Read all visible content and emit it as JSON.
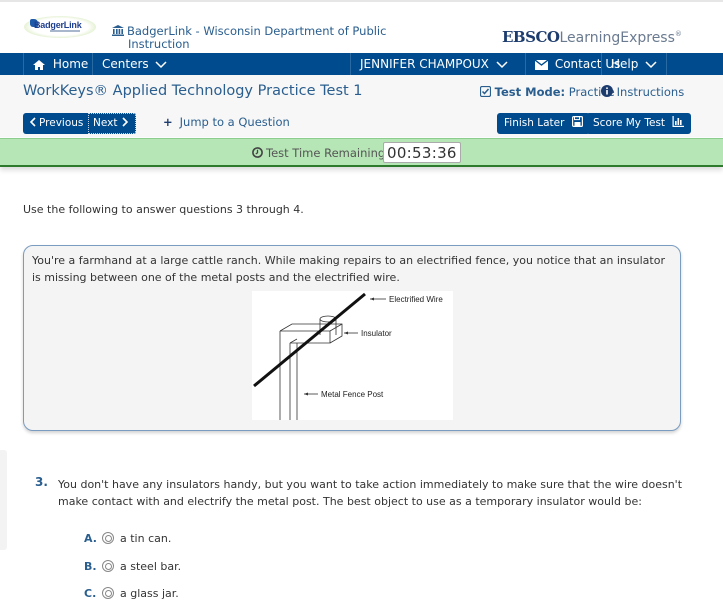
{
  "branding": {
    "logo_text": "BadgerLink",
    "institution": "BadgerLink - Wisconsin Department of Public",
    "institution_line2": "Instruction",
    "ebsco_bold": "EBSCO",
    "ebsco_light": "LearningExpress",
    "ebsco_reg": "®"
  },
  "nav": {
    "home": "Home",
    "centers": "Centers",
    "user": "JENNIFER CHAMPOUX",
    "contact": "Contact Us",
    "help": "Help"
  },
  "header": {
    "title": "WorkKeys® Applied Technology Practice Test 1",
    "test_mode_label": "Test Mode:",
    "test_mode_value": "Practice",
    "instructions": "Instructions"
  },
  "toolbar": {
    "previous": "Previous",
    "next": "Next",
    "jump": "Jump to a Question",
    "finish_later": "Finish Later",
    "score_test": "Score My Test"
  },
  "timer": {
    "label": "Test Time Remaining:",
    "value": "00:53:36"
  },
  "content": {
    "instruction": "Use the following to answer questions 3 through 4.",
    "passage": "You're a farmhand at a large cattle ranch. While making repairs to an electrified fence, you notice that an insulator is missing between one of the metal posts and the electrified wire.",
    "figure": {
      "label_wire": "Electrified Wire",
      "label_insulator": "Insulator",
      "label_post": "Metal Fence Post"
    },
    "question": {
      "number": "3.",
      "text": "You don't have any insulators handy, but you want to take action immediately to make sure that the wire doesn't make contact with and electrify the metal post. The best object to use as a temporary insulator would be:",
      "choices": [
        {
          "letter": "A.",
          "text": "a tin can."
        },
        {
          "letter": "B.",
          "text": "a steel bar."
        },
        {
          "letter": "C.",
          "text": "a glass jar."
        }
      ]
    }
  }
}
